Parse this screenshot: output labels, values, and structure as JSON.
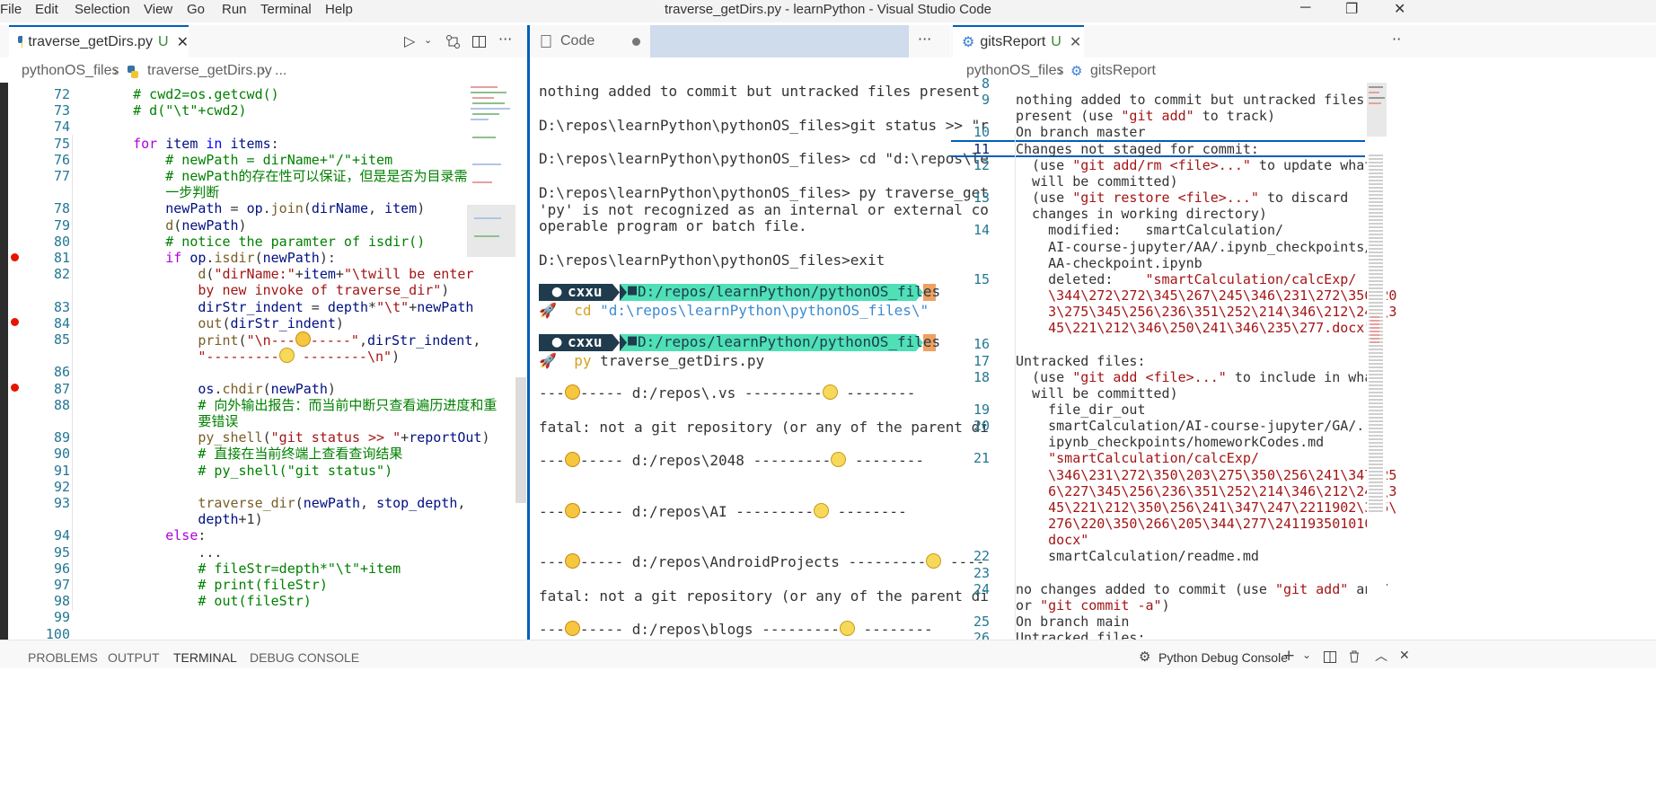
{
  "menu": [
    "File",
    "Edit",
    "Selection",
    "View",
    "Go",
    "Run",
    "Terminal",
    "Help"
  ],
  "window_title": "traverse_getDirs.py - learnPython - Visual Studio Code",
  "left_pane": {
    "tab_label": "traverse_getDirs.py",
    "tab_status": "U",
    "breadcrumb_folder": "pythonOS_files",
    "breadcrumb_file": "traverse_getDirs.py",
    "breadcrumb_more": "...",
    "lines": [
      {
        "n": "72",
        "html": "<span class='cm'>    # cwd2=os.getcwd()</span>"
      },
      {
        "n": "73",
        "html": "<span class='cm'>    # d(\"\\t\"+cwd2)</span>"
      },
      {
        "n": "74",
        "html": ""
      },
      {
        "n": "75",
        "html": "    <span class='kw2'>for</span> <span class='vr'>item</span> <span class='kw'>in</span> <span class='vr'>items</span>:"
      },
      {
        "n": "76",
        "html": "<span class='cm'>        # newPath = dirName+\"/\"+item</span>"
      },
      {
        "n": "77",
        "html": "<span class='cm'>        # newPath的存在性可以保证，但是是否为目录需做进</span>"
      },
      {
        "n": "",
        "html": "<span class='cm'>        一步判断</span>"
      },
      {
        "n": "78",
        "html": "        <span class='vr'>newPath</span> = <span class='vr'>op</span>.<span class='fn'>join</span>(<span class='vr'>dirName</span>, <span class='vr'>item</span>)"
      },
      {
        "n": "79",
        "html": "        <span class='fn'>d</span>(<span class='vr'>newPath</span>)"
      },
      {
        "n": "80",
        "html": "<span class='cm'>        # notice the paramter of isdir()</span>"
      },
      {
        "n": "81",
        "html": "        <span class='kw2'>if</span> <span class='vr'>op</span>.<span class='fn'>isdir</span>(<span class='vr'>newPath</span>):"
      },
      {
        "n": "82",
        "html": "            <span class='fn'>d</span>(<span class='st'>\"dirName:\"</span>+<span class='vr'>item</span>+<span class='st'>\"\\twill be enter</span>"
      },
      {
        "n": "",
        "html": "<span class='st'>            by new invoke of traverse_dir\"</span>)"
      },
      {
        "n": "83",
        "html": "            <span class='vr'>dirStr_indent</span> = <span class='vr'>depth</span>*<span class='st'>\"\\t\"</span>+<span class='vr'>newPath</span>"
      },
      {
        "n": "84",
        "html": "            <span class='fn'>out</span>(<span class='vr'>dirStr_indent</span>)"
      },
      {
        "n": "85",
        "html": "            <span class='fn'>print</span>(<span class='st'>\"\\n---<span class='emo'></span>-----\"</span>,<span class='vr'>dirStr_indent</span>,"
      },
      {
        "n": "",
        "html": "            <span class='st'>\"---------<span class='emo2'></span> --------\\n\"</span>)"
      },
      {
        "n": "86",
        "html": ""
      },
      {
        "n": "87",
        "html": "            <span class='vr'>os</span>.<span class='fn'>chdir</span>(<span class='vr'>newPath</span>)"
      },
      {
        "n": "88",
        "html": "<span class='cm'>            # 向外输出报告：而当前中断只查看遍历进度和重</span>"
      },
      {
        "n": "",
        "html": "<span class='cm'>            要错误</span>"
      },
      {
        "n": "89",
        "html": "            <span class='fn'>py_shell</span>(<span class='st'>\"git status >> \"</span>+<span class='vr'>reportOut</span>)"
      },
      {
        "n": "90",
        "html": "<span class='cm'>            # 直接在当前终端上查看查询结果</span>"
      },
      {
        "n": "91",
        "html": "<span class='cm'>            # py_shell(\"git status\")</span>"
      },
      {
        "n": "92",
        "html": ""
      },
      {
        "n": "93",
        "html": "            <span class='fn'>traverse_dir</span>(<span class='vr'>newPath</span>, <span class='vr'>stop_depth</span>,"
      },
      {
        "n": "",
        "html": "            <span class='vr'>depth</span>+1)"
      },
      {
        "n": "94",
        "html": "        <span class='kw2'>else</span>:"
      },
      {
        "n": "95",
        "html": "            ..."
      },
      {
        "n": "96",
        "html": "<span class='cm'>            # fileStr=depth*\"\\t\"+item</span>"
      },
      {
        "n": "97",
        "html": "<span class='cm'>            # print(fileStr)</span>"
      },
      {
        "n": "98",
        "html": "<span class='cm'>            # out(fileStr)</span>"
      },
      {
        "n": "99",
        "html": ""
      },
      {
        "n": "100",
        "html": ""
      }
    ]
  },
  "middle_pane": {
    "tab_label": "Code",
    "terminal_lines": [
      "nothing added to commit but untracked files present",
      "",
      "D:\\repos\\learnPython\\pythonOS_files>git status >> \"r",
      "",
      "D:\\repos\\learnPython\\pythonOS_files> cd \"d:\\repos\\le",
      "",
      "D:\\repos\\learnPython\\pythonOS_files> py traverse_get",
      "'py' is not recognized as an internal or external co",
      "operable program or batch file.",
      "",
      "D:\\repos\\learnPython\\pythonOS_files>exit"
    ],
    "prompt_user": "cxxu",
    "prompt_path": "D:/repos/learnPython/pythonOS_files",
    "cmd1_kw": "cd",
    "cmd1_arg": "\"d:\\repos\\learnPython\\pythonOS_files\\\"",
    "cmd2_kw": "py",
    "cmd2_arg": "traverse_getDirs.py",
    "output_lines": [
      {
        "pre": "---",
        "mid": "----- d:/repos\\.vs ---------",
        "post": " --------",
        "fatal": false
      },
      {
        "pre": "fatal: not a git repository (or any of the parent di",
        "mid": "",
        "post": "",
        "fatal": true
      },
      {
        "pre": "---",
        "mid": "----- d:/repos\\2048 ---------",
        "post": " --------",
        "fatal": false
      },
      {
        "pre": "---",
        "mid": "----- d:/repos\\AI ---------",
        "post": " --------",
        "fatal": false
      },
      {
        "pre": "---",
        "mid": "----- d:/repos\\AndroidProjects ---------",
        "post": " ----",
        "fatal": false
      },
      {
        "pre": "fatal: not a git repository (or any of the parent di",
        "mid": "",
        "post": "",
        "fatal": true
      },
      {
        "pre": "---",
        "mid": "----- d:/repos\\blogs ---------",
        "post": " --------",
        "fatal": false
      }
    ]
  },
  "right_pane": {
    "tab_label": "gitsReport",
    "tab_status": "U",
    "breadcrumb_folder": "pythonOS_files",
    "breadcrumb_file": "gitsReport",
    "lines": [
      {
        "n": "8",
        "html": ""
      },
      {
        "n": "9",
        "html": "nothing added to commit but untracked files"
      },
      {
        "n": "",
        "html": "present (use <span class='st'>\"git add\"</span> to track)"
      },
      {
        "n": "10",
        "html": "On branch master"
      },
      {
        "n": "11",
        "html": "Changes not staged for commit:"
      },
      {
        "n": "12",
        "html": "  (use <span class='st'>\"git add/rm &lt;file&gt;...\"</span> to update what"
      },
      {
        "n": "",
        "html": "  will be committed)"
      },
      {
        "n": "13",
        "html": "  (use <span class='st'>\"git restore &lt;file&gt;...\"</span> to discard"
      },
      {
        "n": "",
        "html": "  changes in working directory)"
      },
      {
        "n": "14",
        "html": "    modified:   smartCalculation/"
      },
      {
        "n": "",
        "html": "    AI-course-jupyter/AA/.ipynb_checkpoints/"
      },
      {
        "n": "",
        "html": "    AA-checkpoint.ipynb"
      },
      {
        "n": "15",
        "html": "    deleted:    <span class='st'>\"smartCalculation/calcExp/</span>"
      },
      {
        "n": "",
        "html": "<span class='st'>    \\344\\272\\272\\345\\267\\245\\346\\231\\272\\350\\20</span>"
      },
      {
        "n": "",
        "html": "<span class='st'>    3\\275\\345\\256\\236\\351\\252\\214\\346\\212\\245\\3</span>"
      },
      {
        "n": "",
        "html": "<span class='st'>    45\\221\\212\\346\\250\\241\\346\\235\\277.docx\"</span>"
      },
      {
        "n": "16",
        "html": ""
      },
      {
        "n": "17",
        "html": "Untracked files:"
      },
      {
        "n": "18",
        "html": "  (use <span class='st'>\"git add &lt;file&gt;...\"</span> to include in what"
      },
      {
        "n": "",
        "html": "  will be committed)"
      },
      {
        "n": "19",
        "html": "    file_dir_out"
      },
      {
        "n": "20",
        "html": "    smartCalculation/AI-course-jupyter/GA/."
      },
      {
        "n": "",
        "html": "    ipynb_checkpoints/homeworkCodes.md"
      },
      {
        "n": "21",
        "html": "<span class='st'>    \"smartCalculation/calcExp/</span>"
      },
      {
        "n": "",
        "html": "<span class='st'>    \\346\\231\\272\\350\\203\\275\\350\\256\\241\\347\\25</span>"
      },
      {
        "n": "",
        "html": "<span class='st'>    6\\227\\345\\256\\236\\351\\252\\214\\346\\212\\245\\3</span>"
      },
      {
        "n": "",
        "html": "<span class='st'>    45\\221\\212\\350\\256\\241\\347\\247\\2211902\\345\\</span>"
      },
      {
        "n": "",
        "html": "<span class='st'>    276\\220\\350\\266\\205\\344\\277\\2411935010102.</span>"
      },
      {
        "n": "",
        "html": "<span class='st'>    docx\"</span>"
      },
      {
        "n": "22",
        "html": "    smartCalculation/readme.md"
      },
      {
        "n": "23",
        "html": ""
      },
      {
        "n": "24",
        "html": "no changes added to commit (use <span class='st'>\"git add\"</span> and/"
      },
      {
        "n": "",
        "html": "or <span class='st'>\"git commit -a\"</span>)"
      },
      {
        "n": "25",
        "html": "On branch main"
      },
      {
        "n": "26",
        "html": "Untracked files:"
      }
    ]
  },
  "panel": {
    "tabs": [
      "PROBLEMS",
      "OUTPUT",
      "TERMINAL",
      "DEBUG CONSOLE"
    ],
    "active_tab": "TERMINAL",
    "terminal_name": "Python Debug Console"
  },
  "colors": {
    "accent": "#005fb8",
    "prompt_dark": "#1f3b4d",
    "prompt_teal": "#4fe0b6",
    "prompt_orange": "#f0a060",
    "breakpoint": "#e51400"
  }
}
